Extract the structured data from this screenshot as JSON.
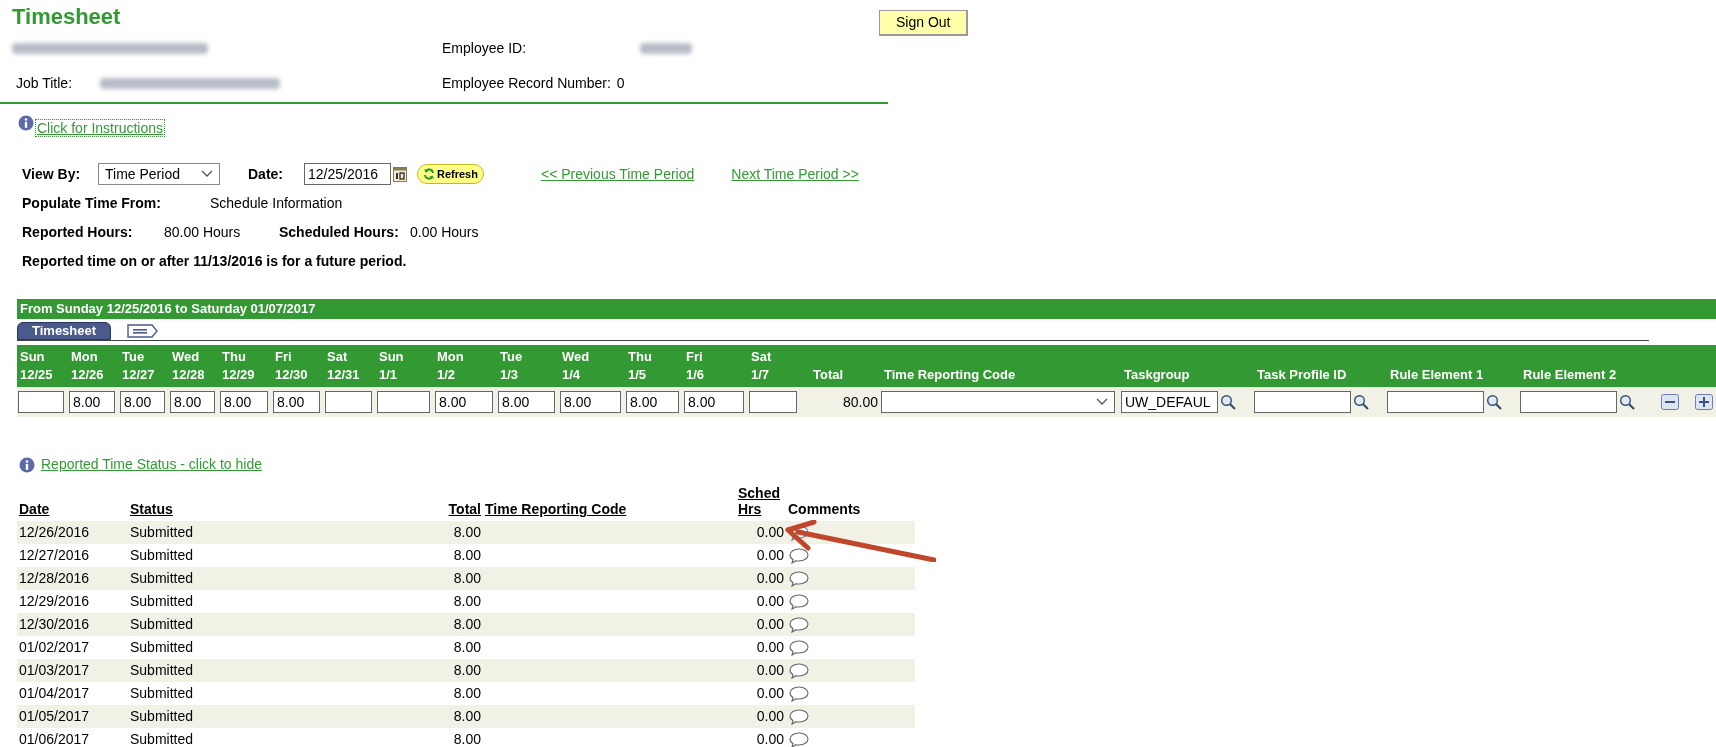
{
  "title": "Timesheet",
  "sign_out": "Sign Out",
  "header": {
    "name": {
      "redacted": true
    },
    "employee_id": {
      "label": "Employee ID:",
      "redacted": true
    },
    "job_title": {
      "label": "Job Title:",
      "redacted": true
    },
    "record": {
      "label": "Employee Record Number:",
      "value": "0"
    }
  },
  "instructions_link": "Click for Instructions",
  "view_by": {
    "label": "View By:",
    "value": "Time Period"
  },
  "date": {
    "label": "Date:",
    "value": "12/25/2016"
  },
  "refresh": "Refresh",
  "prev_link": "<< Previous Time Period",
  "next_link": "Next Time Period >>",
  "populate": {
    "label": "Populate Time From:",
    "value": "Schedule Information"
  },
  "reported": {
    "label": "Reported Hours:",
    "value": "80.00 Hours"
  },
  "scheduled": {
    "label": "Scheduled Hours:",
    "value": "0.00 Hours"
  },
  "notice": "Reported time on or after 11/13/2016 is for a future period.",
  "period_bar": "From Sunday 12/25/2016 to Saturday 01/07/2017",
  "tabs": [
    {
      "kind": "text",
      "label": "Timesheet",
      "selected": true
    },
    {
      "kind": "icon",
      "selected": false
    }
  ],
  "days": [
    {
      "day": "Sun",
      "date": "12/25"
    },
    {
      "day": "Mon",
      "date": "12/26",
      "hours": "8.00"
    },
    {
      "day": "Tue",
      "date": "12/27",
      "hours": "8.00"
    },
    {
      "day": "Wed",
      "date": "12/28",
      "hours": "8.00"
    },
    {
      "day": "Thu",
      "date": "12/29",
      "hours": "8.00"
    },
    {
      "day": "Fri",
      "date": "12/30",
      "hours": "8.00"
    },
    {
      "day": "Sat",
      "date": "12/31"
    },
    {
      "day": "Sun",
      "date": "1/1"
    },
    {
      "day": "Mon",
      "date": "1/2",
      "hours": "8.00"
    },
    {
      "day": "Tue",
      "date": "1/3",
      "hours": "8.00"
    },
    {
      "day": "Wed",
      "date": "1/4",
      "hours": "8.00"
    },
    {
      "day": "Thu",
      "date": "1/5",
      "hours": "8.00"
    },
    {
      "day": "Fri",
      "date": "1/6",
      "hours": "8.00"
    },
    {
      "day": "Sat",
      "date": "1/7"
    }
  ],
  "total": {
    "label": "Total",
    "value": "80.00"
  },
  "fields": [
    {
      "kind": "select",
      "label": "Time Reporting Code"
    },
    {
      "kind": "lookup",
      "label": "Taskgroup",
      "value": "UW_DEFAUL"
    },
    {
      "kind": "lookup",
      "label": "Task Profile ID"
    },
    {
      "kind": "lookup",
      "label": "Rule Element 1"
    },
    {
      "kind": "lookup",
      "label": "Rule Element 2"
    }
  ],
  "row_actions": [
    {
      "kind": "delete"
    },
    {
      "kind": "add"
    }
  ],
  "status_link": "Reported Time Status - click to hide",
  "status_table": {
    "columns": [
      {
        "label": "Date",
        "sortable": true
      },
      {
        "label": "Status",
        "sortable": true
      },
      {
        "label": "Total",
        "sortable": true
      },
      {
        "label": "Time Reporting Code",
        "sortable": true
      },
      {
        "label": "Sched Hrs",
        "sortable": true
      },
      {
        "label": "Comments",
        "sortable": false
      }
    ],
    "rows": [
      {
        "date": "12/26/2016",
        "status": "Submitted",
        "total": "8.00",
        "sched": "0.00",
        "has_comment": true
      },
      {
        "date": "12/27/2016",
        "status": "Submitted",
        "total": "8.00",
        "sched": "0.00",
        "has_comment": false
      },
      {
        "date": "12/28/2016",
        "status": "Submitted",
        "total": "8.00",
        "sched": "0.00",
        "has_comment": false
      },
      {
        "date": "12/29/2016",
        "status": "Submitted",
        "total": "8.00",
        "sched": "0.00",
        "has_comment": false
      },
      {
        "date": "12/30/2016",
        "status": "Submitted",
        "total": "8.00",
        "sched": "0.00",
        "has_comment": false
      },
      {
        "date": "01/02/2017",
        "status": "Submitted",
        "total": "8.00",
        "sched": "0.00",
        "has_comment": false
      },
      {
        "date": "01/03/2017",
        "status": "Submitted",
        "total": "8.00",
        "sched": "0.00",
        "has_comment": false
      },
      {
        "date": "01/04/2017",
        "status": "Submitted",
        "total": "8.00",
        "sched": "0.00",
        "has_comment": false
      },
      {
        "date": "01/05/2017",
        "status": "Submitted",
        "total": "8.00",
        "sched": "0.00",
        "has_comment": false
      },
      {
        "date": "01/06/2017",
        "status": "Submitted",
        "total": "8.00",
        "sched": "0.00",
        "has_comment": false
      }
    ]
  },
  "annotation": {
    "kind": "arrow"
  }
}
